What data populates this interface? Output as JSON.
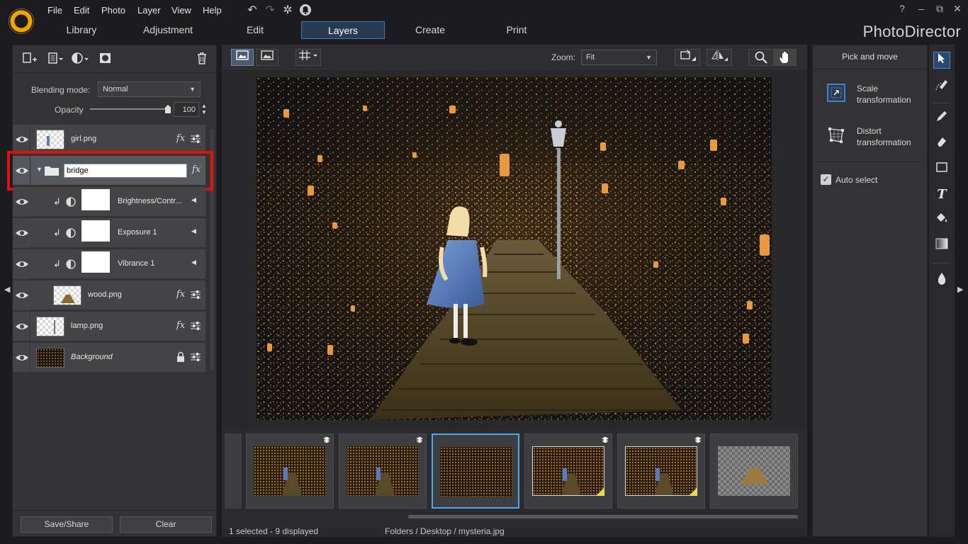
{
  "menu": [
    "File",
    "Edit",
    "Photo",
    "Layer",
    "View",
    "Help"
  ],
  "tabs": [
    "Library",
    "Adjustment",
    "Edit",
    "Layers",
    "Create",
    "Print"
  ],
  "active_tab": "Layers",
  "app_title": "PhotoDirector",
  "window_controls": [
    "?",
    "–",
    "⧉",
    "✕"
  ],
  "left": {
    "blending_label": "Blending mode:",
    "blending_value": "Normal",
    "opacity_label": "Opacity",
    "opacity_value": "100",
    "opacity_fraction": 1.0,
    "layers": [
      {
        "name": "girl.png",
        "type": "image",
        "fx": "fx"
      },
      {
        "name": "bridge",
        "type": "group",
        "fx": "fx",
        "editing": true
      },
      {
        "name": "Brightness/Contr...",
        "type": "adjustment"
      },
      {
        "name": "Exposure 1",
        "type": "adjustment"
      },
      {
        "name": "Vibrance 1",
        "type": "adjustment"
      },
      {
        "name": "wood.png",
        "type": "image",
        "fx": "fx"
      },
      {
        "name": "lamp.png",
        "type": "image",
        "fx": "fx"
      },
      {
        "name": "Background",
        "type": "background"
      }
    ],
    "save_share": "Save/Share",
    "clear": "Clear"
  },
  "center": {
    "zoom_label": "Zoom:",
    "zoom_value": "Fit"
  },
  "status": {
    "selection": "1 selected - 9 displayed",
    "path": "Folders / Desktop / mysteria.jpg"
  },
  "right": {
    "title": "Pick and move",
    "scale": "Scale\ntransformation",
    "distort": "Distort\ntransformation",
    "auto_select": "Auto select",
    "auto_select_checked": true
  },
  "colors": {
    "accent": "#4aa8f0",
    "highlight_box": "#e01010",
    "logo": "#f0a400"
  }
}
